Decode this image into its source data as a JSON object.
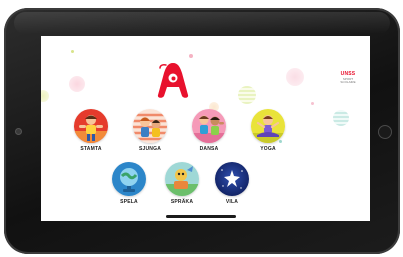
{
  "app": {
    "logo_letter": "A",
    "brand_name": "UNSS",
    "brand_sub": "SPORT SCOLAIRE"
  },
  "colors": {
    "logo_red": "#e8112d",
    "label_text": "#222222",
    "tablet_frame": "#161616"
  },
  "activities": [
    {
      "label": "STAMTA",
      "icon": "kids-exercising-illustration"
    },
    {
      "label": "SJUNGA",
      "icon": "kids-singing-illustration"
    },
    {
      "label": "DANSA",
      "icon": "kids-dancing-illustration"
    },
    {
      "label": "YOGA",
      "icon": "kid-yoga-illustration"
    },
    {
      "label": "SPELA",
      "icon": "globe-play-illustration"
    },
    {
      "label": "SPRÄKA",
      "icon": "character-reading-illustration"
    },
    {
      "label": "VILA",
      "icon": "night-sky-star-illustration"
    }
  ]
}
